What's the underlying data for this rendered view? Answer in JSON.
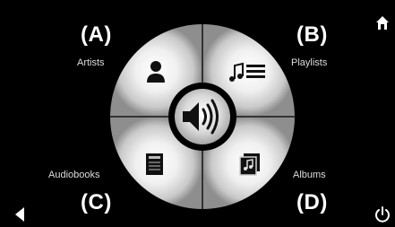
{
  "labels": {
    "A": "(A)",
    "B": "(B)",
    "C": "(C)",
    "D": "(D)"
  },
  "menu": {
    "artists": "Artists",
    "playlists": "Playlists",
    "audiobooks": "Audiobooks",
    "albums": "Albums"
  },
  "icons": {
    "top_right": "home-icon",
    "bottom_left": "back-icon",
    "bottom_right": "power-icon",
    "center": "speaker-icon",
    "artists": "person-icon",
    "playlists": "playlist-icon",
    "audiobooks": "book-icon",
    "albums": "album-icon"
  },
  "colors": {
    "background": "#000000",
    "dial_light": "#f2f2f2",
    "dial_dark": "#8d8d8d",
    "icon_dark": "#111111"
  }
}
